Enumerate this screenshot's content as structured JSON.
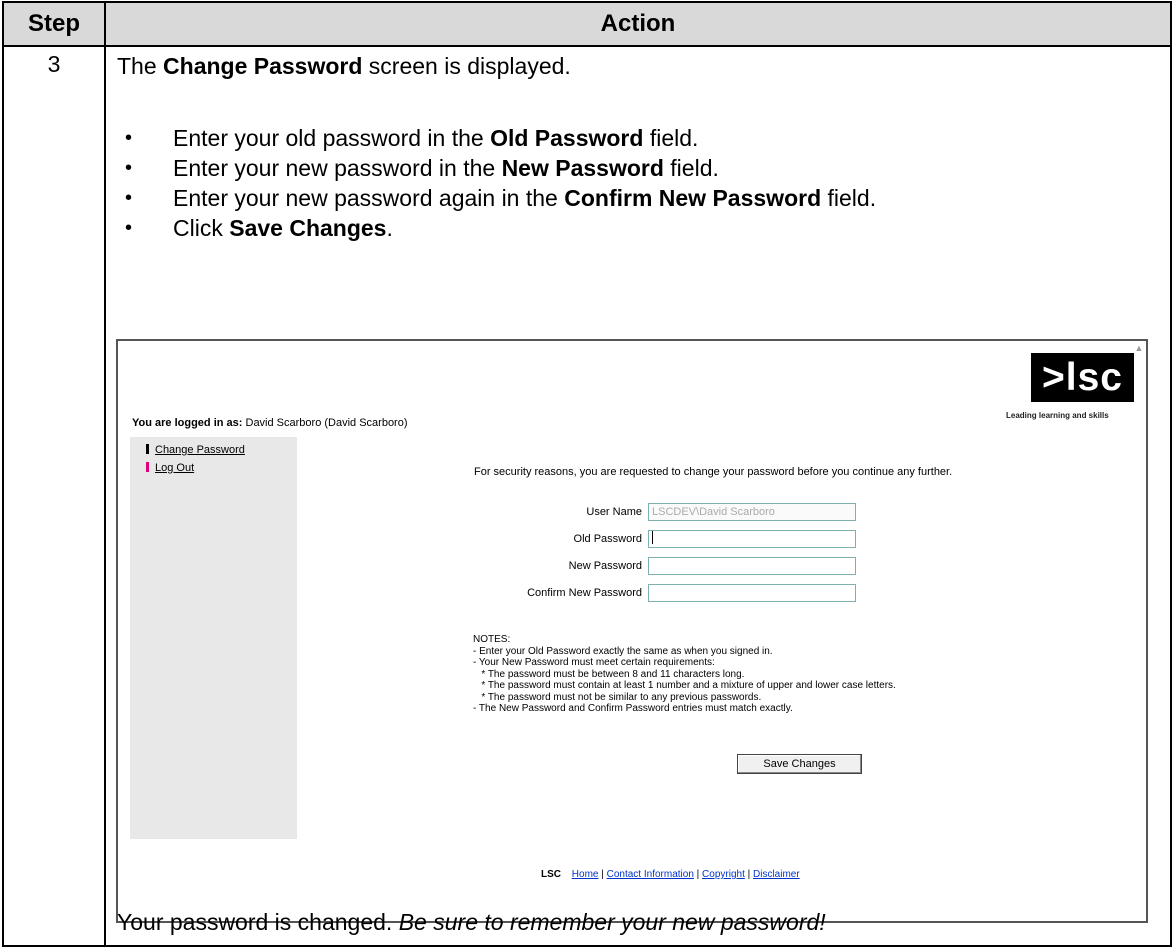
{
  "table": {
    "header_step": "Step",
    "header_action": "Action",
    "step_number": "3"
  },
  "intro": {
    "pre": "The ",
    "bold": "Change Password",
    "post": " screen is displayed."
  },
  "bullets": [
    {
      "pre": "Enter your old password in the ",
      "bold": "Old Password",
      "post": " field."
    },
    {
      "pre": "Enter your new password in the ",
      "bold": "New Password",
      "post": " field."
    },
    {
      "pre": "Enter your new password again in the ",
      "bold": "Confirm New Password",
      "post": " field."
    },
    {
      "pre": "Click ",
      "bold": "Save Changes",
      "post": "."
    }
  ],
  "outro": {
    "plain": "Your password is changed.  ",
    "italic": "Be sure to remember your new password!"
  },
  "screenshot": {
    "logo_text": ">lsc",
    "logo_tagline": "Leading learning and skills",
    "logged_in_label": "You are logged in as:",
    "logged_in_user": " David Scarboro (David Scarboro)",
    "sidebar": [
      {
        "label": "Change Password",
        "marker_color": "#000000"
      },
      {
        "label": "Log Out",
        "marker_color": "#e0007a"
      }
    ],
    "security_message": "For security reasons, you are requested to change your password before you continue any further.",
    "form": {
      "user_name_label": "User Name",
      "user_name_value": "LSCDEV\\David Scarboro",
      "old_password_label": "Old Password",
      "new_password_label": "New Password",
      "confirm_password_label": "Confirm New Password"
    },
    "notes": [
      "NOTES:",
      "- Enter your Old Password exactly the same as when you signed in.",
      "- Your New Password must meet certain requirements:",
      "   * The password must be between 8 and 11 characters long.",
      "   * The password must contain at least 1 number and a mixture of upper and lower case letters.",
      "   * The password must not be similar to any previous passwords.",
      "- The New Password and Confirm Password entries must match exactly."
    ],
    "save_button": "Save Changes",
    "footer": {
      "brand": "LSC",
      "links": [
        "Home",
        "Contact Information",
        "Copyright",
        "Disclaimer"
      ],
      "separator": " | "
    }
  }
}
